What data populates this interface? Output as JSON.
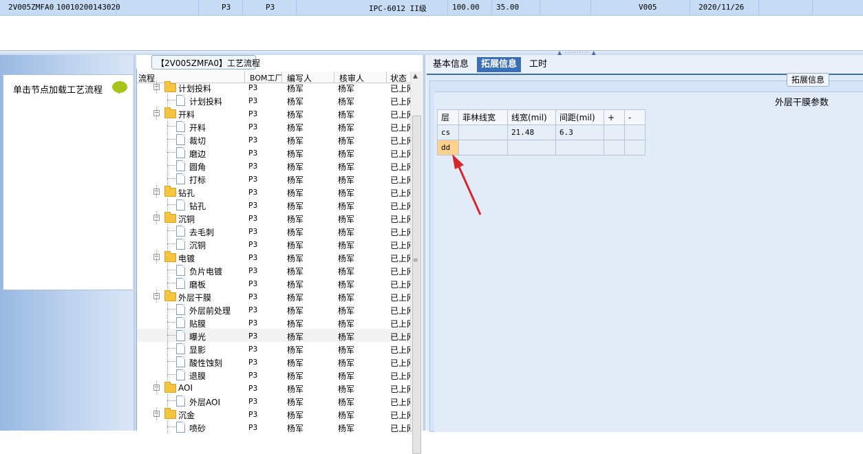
{
  "top_row": {
    "cells": [
      "2V005ZMFA0",
      "10010200143020",
      "P3",
      "P3",
      "IPC-6012 II级",
      "100.00",
      "35.00",
      "V005",
      "2020/11/26"
    ]
  },
  "left_panel": {
    "header": "单击节点加载工艺流程",
    "chat_icon": "speech-bubble-icon"
  },
  "tree_panel": {
    "title": "【2V005ZMFA0】工艺流程",
    "columns": [
      "流程",
      "BOM工厂",
      "编写人",
      "核审人",
      "状态"
    ],
    "rows": [
      {
        "name": "计划投料",
        "level": 0,
        "bom": "P3",
        "writer": "杨军",
        "reviewer": "杨军",
        "status": "已上网",
        "partial": true
      },
      {
        "name": "计划投料",
        "level": 1,
        "bom": "P3",
        "writer": "杨军",
        "reviewer": "杨军",
        "status": "已上网"
      },
      {
        "name": "开料",
        "level": 0,
        "bom": "P3",
        "writer": "杨军",
        "reviewer": "杨军",
        "status": "已上网"
      },
      {
        "name": "开料",
        "level": 1,
        "bom": "P3",
        "writer": "杨军",
        "reviewer": "杨军",
        "status": "已上网"
      },
      {
        "name": "裁切",
        "level": 1,
        "bom": "P3",
        "writer": "杨军",
        "reviewer": "杨军",
        "status": "已上网"
      },
      {
        "name": "磨边",
        "level": 1,
        "bom": "P3",
        "writer": "杨军",
        "reviewer": "杨军",
        "status": "已上网"
      },
      {
        "name": "圆角",
        "level": 1,
        "bom": "P3",
        "writer": "杨军",
        "reviewer": "杨军",
        "status": "已上网"
      },
      {
        "name": "打标",
        "level": 1,
        "bom": "P3",
        "writer": "杨军",
        "reviewer": "杨军",
        "status": "已上网"
      },
      {
        "name": "钻孔",
        "level": 0,
        "bom": "P3",
        "writer": "杨军",
        "reviewer": "杨军",
        "status": "已上网"
      },
      {
        "name": "钻孔",
        "level": 1,
        "bom": "P3",
        "writer": "杨军",
        "reviewer": "杨军",
        "status": "已上网"
      },
      {
        "name": "沉铜",
        "level": 0,
        "bom": "P3",
        "writer": "杨军",
        "reviewer": "杨军",
        "status": "已上网"
      },
      {
        "name": "去毛刺",
        "level": 1,
        "bom": "P3",
        "writer": "杨军",
        "reviewer": "杨军",
        "status": "已上网"
      },
      {
        "name": "沉铜",
        "level": 1,
        "bom": "P3",
        "writer": "杨军",
        "reviewer": "杨军",
        "status": "已上网"
      },
      {
        "name": "电镀",
        "level": 0,
        "bom": "P3",
        "writer": "杨军",
        "reviewer": "杨军",
        "status": "已上网"
      },
      {
        "name": "负片电镀",
        "level": 1,
        "bom": "P3",
        "writer": "杨军",
        "reviewer": "杨军",
        "status": "已上网"
      },
      {
        "name": "磨板",
        "level": 1,
        "bom": "P3",
        "writer": "杨军",
        "reviewer": "杨军",
        "status": "已上网"
      },
      {
        "name": "外层干膜",
        "level": 0,
        "bom": "P3",
        "writer": "杨军",
        "reviewer": "杨军",
        "status": "已上网"
      },
      {
        "name": "外层前处理",
        "level": 1,
        "bom": "P3",
        "writer": "杨军",
        "reviewer": "杨军",
        "status": "已上网"
      },
      {
        "name": "贴膜",
        "level": 1,
        "bom": "P3",
        "writer": "杨军",
        "reviewer": "杨军",
        "status": "已上网"
      },
      {
        "name": "曝光",
        "level": 1,
        "bom": "P3",
        "writer": "杨军",
        "reviewer": "杨军",
        "status": "已上网",
        "selected": true
      },
      {
        "name": "显影",
        "level": 1,
        "bom": "P3",
        "writer": "杨军",
        "reviewer": "杨军",
        "status": "已上网"
      },
      {
        "name": "酸性蚀刻",
        "level": 1,
        "bom": "P3",
        "writer": "杨军",
        "reviewer": "杨军",
        "status": "已上网"
      },
      {
        "name": "退膜",
        "level": 1,
        "bom": "P3",
        "writer": "杨军",
        "reviewer": "杨军",
        "status": "已上网"
      },
      {
        "name": "AOI",
        "level": 0,
        "bom": "P3",
        "writer": "杨军",
        "reviewer": "杨军",
        "status": "已上网"
      },
      {
        "name": "外层AOI",
        "level": 1,
        "bom": "P3",
        "writer": "杨军",
        "reviewer": "杨军",
        "status": "已上网"
      },
      {
        "name": "沉金",
        "level": 0,
        "bom": "P3",
        "writer": "杨军",
        "reviewer": "杨军",
        "status": "已上网"
      },
      {
        "name": "喷砂",
        "level": 1,
        "bom": "P3",
        "writer": "杨军",
        "reviewer": "杨军",
        "status": "已上网"
      }
    ]
  },
  "right_panel": {
    "tabs": [
      "基本信息",
      "拓展信息",
      "工时"
    ],
    "active_tab": 1,
    "group_title": "拓展信息",
    "param_title": "外层干膜参数",
    "param_table": {
      "headers": [
        "层",
        "菲林线宽",
        "线宽(mil)",
        "间距(mil)",
        "+",
        "-"
      ],
      "rows": [
        [
          "cs",
          "",
          "21.48",
          "6.3",
          "",
          ""
        ],
        [
          "dd",
          "",
          "",
          "",
          "",
          ""
        ]
      ]
    },
    "annotation_color": "#d6262b"
  },
  "colors": {
    "top_row_bg": "#c6dcf4",
    "tab_active": "#3b6fb7",
    "folder": "#f5c542",
    "header_cell_orange": "#fbd38f"
  }
}
